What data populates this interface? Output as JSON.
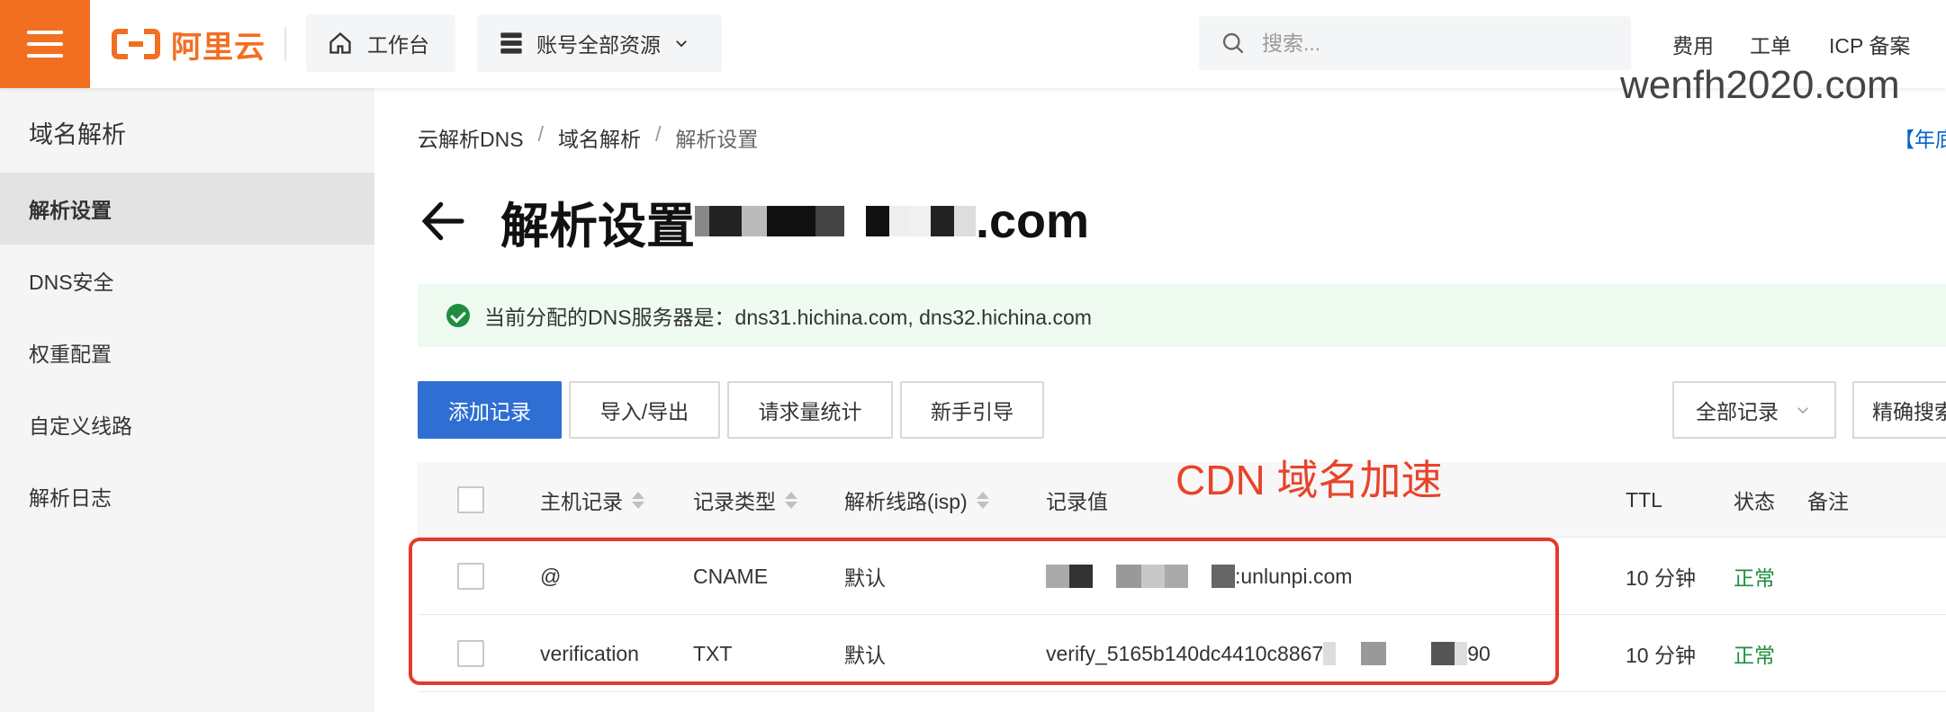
{
  "header": {
    "logo_text": "阿里云",
    "workbench_label": "工作台",
    "resources_label": "账号全部资源",
    "search_placeholder": "搜索...",
    "links": [
      "费用",
      "工单",
      "ICP 备案"
    ]
  },
  "watermark": "wenfh2020.com",
  "sidebar": {
    "title": "域名解析",
    "items": [
      {
        "label": "解析设置",
        "active": true
      },
      {
        "label": "DNS安全",
        "active": false
      },
      {
        "label": "权重配置",
        "active": false
      },
      {
        "label": "自定义线路",
        "active": false
      },
      {
        "label": "解析日志",
        "active": false
      }
    ]
  },
  "breadcrumb": [
    "云解析DNS",
    "域名解析",
    "解析设置"
  ],
  "promo_link": "【年底",
  "page": {
    "title": "解析设置",
    "domain_suffix": ".com"
  },
  "notice": "当前分配的DNS服务器是：dns31.hichina.com, dns32.hichina.com",
  "toolbar": {
    "add": "添加记录",
    "import_export": "导入/导出",
    "request_stats": "请求量统计",
    "guide": "新手引导",
    "filter_all": "全部记录",
    "precise_search": "精确搜索"
  },
  "table": {
    "columns": [
      "主机记录",
      "记录类型",
      "解析线路(isp)",
      "记录值",
      "TTL",
      "状态",
      "备注"
    ],
    "rows": [
      {
        "host": "@",
        "type": "CNAME",
        "line": "默认",
        "value_visible": ":unlunpi.com",
        "ttl": "10 分钟",
        "status": "正常"
      },
      {
        "host": "verification",
        "type": "TXT",
        "line": "默认",
        "value_visible": "verify_5165b140dc4410c8867",
        "value_tail": "90",
        "ttl": "10 分钟",
        "status": "正常"
      }
    ]
  },
  "annotation": "CDN 域名加速",
  "colors": {
    "brand": "#f26f21",
    "primary": "#2f6fd3",
    "success": "#1e8e3e",
    "annotation": "#e23b2d"
  }
}
